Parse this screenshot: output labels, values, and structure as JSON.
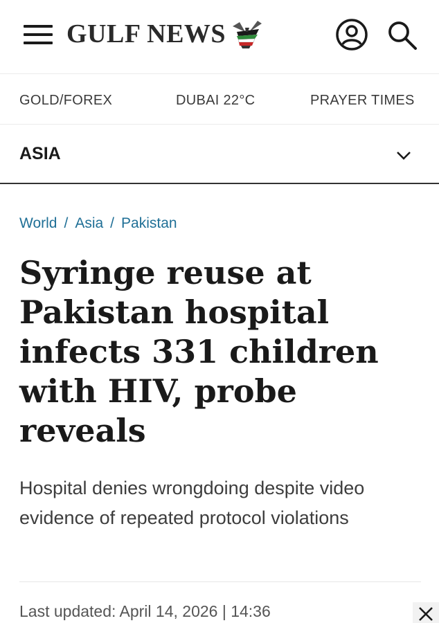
{
  "header": {
    "logo_text": "GULF NEWS",
    "icons": [
      "menu-icon",
      "falcon-logo",
      "account-icon",
      "search-icon"
    ]
  },
  "quicklinks": {
    "gold_forex": "GOLD/FOREX",
    "weather": "DUBAI 22°C",
    "prayer_times": "PRAYER TIMES"
  },
  "section": {
    "title": "ASIA"
  },
  "breadcrumb": {
    "items": [
      "World",
      "Asia",
      "Pakistan"
    ],
    "separator": "/"
  },
  "article": {
    "headline": "Syringe reuse at Pakistan hospital infects 331 children with HIV, probe reveals",
    "subhead": "Hospital denies wrongdoing despite video evidence of repeated protocol violations",
    "last_updated": "Last updated: April 14, 2026 | 14:36"
  },
  "colors": {
    "link": "#1f6f96",
    "text": "#1a1a1a"
  }
}
